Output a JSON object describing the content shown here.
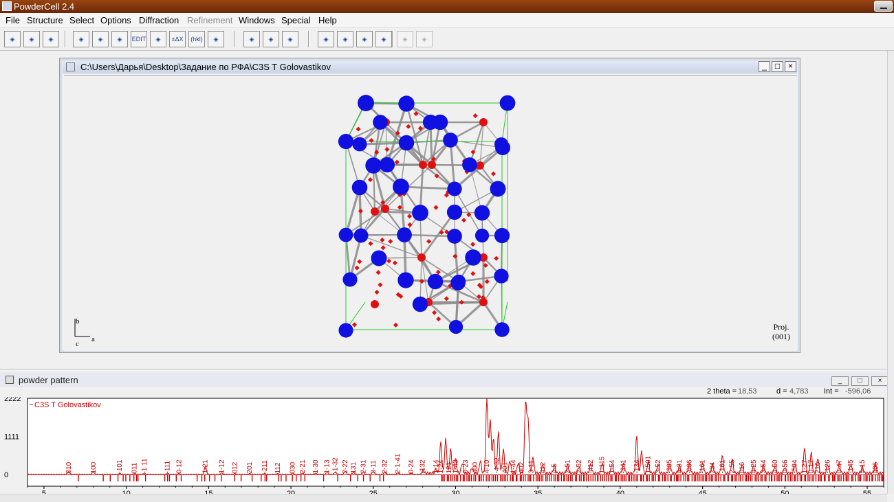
{
  "app": {
    "title": "PowderCell 2.4"
  },
  "menu": [
    "File",
    "Structure",
    "Select",
    "Options",
    "Diffraction",
    "Refinement",
    "Windows",
    "Special",
    "Help"
  ],
  "menu_disabled": [
    "Refinement"
  ],
  "toolbar": [
    {
      "icon": "open-folder-icon"
    },
    {
      "icon": "document-properties-icon"
    },
    {
      "icon": "clipboard-icon"
    },
    {
      "icon": "crystal-structure-icon"
    },
    {
      "icon": "atoms-icon"
    },
    {
      "icon": "graph-icon"
    },
    {
      "icon": "edit-icon",
      "label": "EDIT"
    },
    {
      "icon": "move-atoms-icon"
    },
    {
      "icon": "delta-x-icon",
      "label": "±ΔX"
    },
    {
      "icon": "hkl-icon",
      "label": "(hkl)"
    },
    {
      "icon": "3d-view-icon"
    },
    {
      "icon": "print-icon"
    },
    {
      "icon": "print-preview-icon"
    },
    {
      "icon": "print-setup-icon"
    },
    {
      "icon": "target-icon"
    },
    {
      "icon": "balance-icon"
    },
    {
      "icon": "color-palette-icon"
    },
    {
      "icon": "table-icon"
    },
    {
      "icon": "grid-icon",
      "disabled": true
    },
    {
      "icon": "chart-axes-icon",
      "disabled": true
    }
  ],
  "structure_window": {
    "title": "C:\\Users\\Дарья\\Desktop\\Задание по РФА\\C3S T  Golovastikov",
    "proj_label": "Proj.",
    "proj_value": "(001)",
    "axis_b": "b",
    "axis_a": "a",
    "axis_c": "c",
    "colors": {
      "cation": "#1010e0",
      "anion": "#e01010",
      "bond": "#8a8a8a",
      "cell": "#22cc22"
    }
  },
  "pattern_window": {
    "title": "powder pattern",
    "two_theta_label": "2 theta =",
    "two_theta": "18,53",
    "d_label": "d =",
    "d": "4,783",
    "int_label": "Int =",
    "int": "-596,06",
    "legend": "C3S T  Golovastikov",
    "color": "#cc0000"
  },
  "chart_data": {
    "type": "line",
    "series": [
      {
        "name": "C3S T  Golovastikov"
      }
    ],
    "xlim": [
      4,
      56
    ],
    "ylim": [
      -200,
      2222
    ],
    "xticks": [
      5,
      10,
      15,
      20,
      25,
      30,
      35,
      40,
      45,
      50,
      55
    ],
    "yticks": [
      "2222",
      "1111",
      "0"
    ],
    "peaks": [
      {
        "x": 6.5,
        "y": 80
      },
      {
        "x": 8.0,
        "y": 60
      },
      {
        "x": 9.6,
        "y": 20
      },
      {
        "x": 10.5,
        "y": 20
      },
      {
        "x": 11.1,
        "y": 20
      },
      {
        "x": 12.5,
        "y": 20
      },
      {
        "x": 13.2,
        "y": 20
      },
      {
        "x": 14.8,
        "y": 240
      },
      {
        "x": 15.8,
        "y": 40
      },
      {
        "x": 16.6,
        "y": 20
      },
      {
        "x": 17.5,
        "y": 20
      },
      {
        "x": 18.4,
        "y": 20
      },
      {
        "x": 19.2,
        "y": 20
      },
      {
        "x": 20.1,
        "y": 30
      },
      {
        "x": 20.7,
        "y": 30
      },
      {
        "x": 21.5,
        "y": 30
      },
      {
        "x": 22.2,
        "y": 50
      },
      {
        "x": 22.7,
        "y": 70
      },
      {
        "x": 23.3,
        "y": 90
      },
      {
        "x": 23.8,
        "y": 60
      },
      {
        "x": 24.4,
        "y": 60
      },
      {
        "x": 25.0,
        "y": 80
      },
      {
        "x": 25.7,
        "y": 60
      },
      {
        "x": 26.5,
        "y": 40
      },
      {
        "x": 27.3,
        "y": 30
      },
      {
        "x": 28.0,
        "y": 90
      },
      {
        "x": 28.8,
        "y": 120
      },
      {
        "x": 29.1,
        "y": 900
      },
      {
        "x": 29.4,
        "y": 1000
      },
      {
        "x": 29.7,
        "y": 700
      },
      {
        "x": 30.0,
        "y": 420
      },
      {
        "x": 30.4,
        "y": 300
      },
      {
        "x": 31.0,
        "y": 150
      },
      {
        "x": 31.5,
        "y": 360
      },
      {
        "x": 31.9,
        "y": 2222
      },
      {
        "x": 32.1,
        "y": 1600
      },
      {
        "x": 32.3,
        "y": 1000
      },
      {
        "x": 32.6,
        "y": 1200
      },
      {
        "x": 32.9,
        "y": 700
      },
      {
        "x": 33.3,
        "y": 360
      },
      {
        "x": 33.8,
        "y": 300
      },
      {
        "x": 34.25,
        "y": 2100
      },
      {
        "x": 34.4,
        "y": 1600
      },
      {
        "x": 34.7,
        "y": 500
      },
      {
        "x": 35.3,
        "y": 250
      },
      {
        "x": 36.0,
        "y": 220
      },
      {
        "x": 36.8,
        "y": 250
      },
      {
        "x": 37.5,
        "y": 200
      },
      {
        "x": 38.2,
        "y": 260
      },
      {
        "x": 38.9,
        "y": 300
      },
      {
        "x": 39.5,
        "y": 260
      },
      {
        "x": 40.2,
        "y": 280
      },
      {
        "x": 41.0,
        "y": 1100
      },
      {
        "x": 41.3,
        "y": 650
      },
      {
        "x": 41.7,
        "y": 350
      },
      {
        "x": 42.3,
        "y": 250
      },
      {
        "x": 43.0,
        "y": 260
      },
      {
        "x": 43.6,
        "y": 230
      },
      {
        "x": 44.2,
        "y": 260
      },
      {
        "x": 45.0,
        "y": 300
      },
      {
        "x": 45.6,
        "y": 250
      },
      {
        "x": 46.2,
        "y": 500
      },
      {
        "x": 46.8,
        "y": 400
      },
      {
        "x": 47.4,
        "y": 250
      },
      {
        "x": 48.1,
        "y": 200
      },
      {
        "x": 48.7,
        "y": 220
      },
      {
        "x": 49.4,
        "y": 220
      },
      {
        "x": 50.0,
        "y": 180
      },
      {
        "x": 50.6,
        "y": 300
      },
      {
        "x": 51.2,
        "y": 750
      },
      {
        "x": 51.6,
        "y": 600
      },
      {
        "x": 52.0,
        "y": 450
      },
      {
        "x": 52.6,
        "y": 260
      },
      {
        "x": 53.3,
        "y": 300
      },
      {
        "x": 54.0,
        "y": 250
      },
      {
        "x": 54.7,
        "y": 200
      },
      {
        "x": 55.5,
        "y": 300
      }
    ],
    "hkl_labels": [
      {
        "x": 6.5,
        "text": "010"
      },
      {
        "x": 8.0,
        "text": "100"
      },
      {
        "x": 9.6,
        "text": "-101"
      },
      {
        "x": 10.5,
        "text": "011"
      },
      {
        "x": 11.1,
        "text": "-1 11"
      },
      {
        "x": 12.5,
        "text": "-111"
      },
      {
        "x": 13.2,
        "text": "0-12"
      },
      {
        "x": 14.8,
        "text": "1-21"
      },
      {
        "x": 15.8,
        "text": "1-12"
      },
      {
        "x": 16.6,
        "text": "012"
      },
      {
        "x": 17.5,
        "text": "201"
      },
      {
        "x": 18.4,
        "text": "-211"
      },
      {
        "x": 19.2,
        "text": "112"
      },
      {
        "x": 20.1,
        "text": "030"
      },
      {
        "x": 20.7,
        "text": "2-21"
      },
      {
        "x": 21.5,
        "text": "1-30"
      },
      {
        "x": 22.2,
        "text": "1-13"
      },
      {
        "x": 22.7,
        "text": "-1-32"
      },
      {
        "x": 23.3,
        "text": "2-22"
      },
      {
        "x": 23.8,
        "text": "131"
      },
      {
        "x": 24.4,
        "text": "2-31"
      },
      {
        "x": 25.0,
        "text": "3-11"
      },
      {
        "x": 25.7,
        "text": "2-32"
      },
      {
        "x": 26.5,
        "text": "2-1-41"
      },
      {
        "x": 27.3,
        "text": "0-24"
      },
      {
        "x": 28.0,
        "text": "-132"
      },
      {
        "x": 28.8,
        "text": "1-14"
      },
      {
        "x": 29.1,
        "text": "1-24"
      },
      {
        "x": 29.6,
        "text": "121"
      },
      {
        "x": 30.0,
        "text": "1-43"
      },
      {
        "x": 30.6,
        "text": "0-23"
      },
      {
        "x": 31.2,
        "text": "400"
      },
      {
        "x": 31.9,
        "text": "4-10"
      },
      {
        "x": 32.5,
        "text": "-4-32"
      },
      {
        "x": 33.0,
        "text": "401"
      },
      {
        "x": 33.5,
        "text": "1-44"
      },
      {
        "x": 34.0,
        "text": "402"
      },
      {
        "x": 34.6,
        "text": "3-11"
      },
      {
        "x": 35.3,
        "text": "412"
      },
      {
        "x": 36.0,
        "text": "4-5"
      },
      {
        "x": 36.8,
        "text": "2-51"
      },
      {
        "x": 37.5,
        "text": "2-52"
      },
      {
        "x": 38.2,
        "text": "-412"
      },
      {
        "x": 38.9,
        "text": "1-115"
      },
      {
        "x": 39.5,
        "text": "1-54"
      },
      {
        "x": 40.2,
        "text": "-341"
      },
      {
        "x": 41.0,
        "text": "-134"
      },
      {
        "x": 41.7,
        "text": "1-501"
      },
      {
        "x": 42.3,
        "text": "3-52"
      },
      {
        "x": 43.0,
        "text": "-305"
      },
      {
        "x": 43.6,
        "text": "4-31"
      },
      {
        "x": 44.2,
        "text": "-006"
      },
      {
        "x": 45.0,
        "text": "-161"
      },
      {
        "x": 45.6,
        "text": "234"
      },
      {
        "x": 46.2,
        "text": "-161"
      },
      {
        "x": 46.8,
        "text": "2-55"
      },
      {
        "x": 47.4,
        "text": "016"
      },
      {
        "x": 48.1,
        "text": "4-25"
      },
      {
        "x": 48.7,
        "text": "3-54"
      },
      {
        "x": 49.4,
        "text": "4-50"
      },
      {
        "x": 50.0,
        "text": "0-56"
      },
      {
        "x": 50.6,
        "text": "-504"
      },
      {
        "x": 51.2,
        "text": "1-27"
      },
      {
        "x": 51.6,
        "text": "0-17"
      },
      {
        "x": 52.0,
        "text": "216"
      },
      {
        "x": 52.6,
        "text": "-126"
      },
      {
        "x": 53.3,
        "text": "0-47"
      },
      {
        "x": 54.0,
        "text": "-145"
      },
      {
        "x": 54.7,
        "text": "5-15"
      },
      {
        "x": 55.5,
        "text": "406"
      }
    ]
  }
}
